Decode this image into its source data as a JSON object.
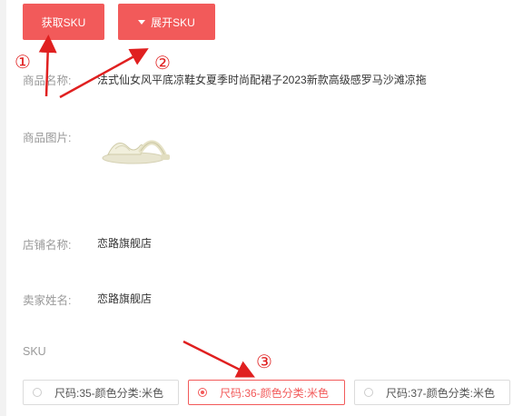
{
  "toolbar": {
    "get_sku_label": "获取SKU",
    "expand_sku_label": "展开SKU"
  },
  "product": {
    "name_label": "商品名称:",
    "name_value": "法式仙女风平底凉鞋女夏季时尚配裙子2023新款高级感罗马沙滩凉拖",
    "image_label": "商品图片:",
    "store_label": "店铺名称:",
    "store_value": "恋路旗舰店",
    "seller_label": "卖家姓名:",
    "seller_value": "恋路旗舰店"
  },
  "sku": {
    "title": "SKU",
    "options": [
      {
        "label": "尺码:35-颜色分类:米色",
        "selected": false
      },
      {
        "label": "尺码:36-颜色分类:米色",
        "selected": true
      },
      {
        "label": "尺码:37-颜色分类:米色",
        "selected": false
      }
    ]
  },
  "annotations": {
    "marker_1": "①",
    "marker_2": "②",
    "marker_3": "③",
    "color": "#e02020"
  },
  "colors": {
    "accent": "#f25a5a"
  }
}
